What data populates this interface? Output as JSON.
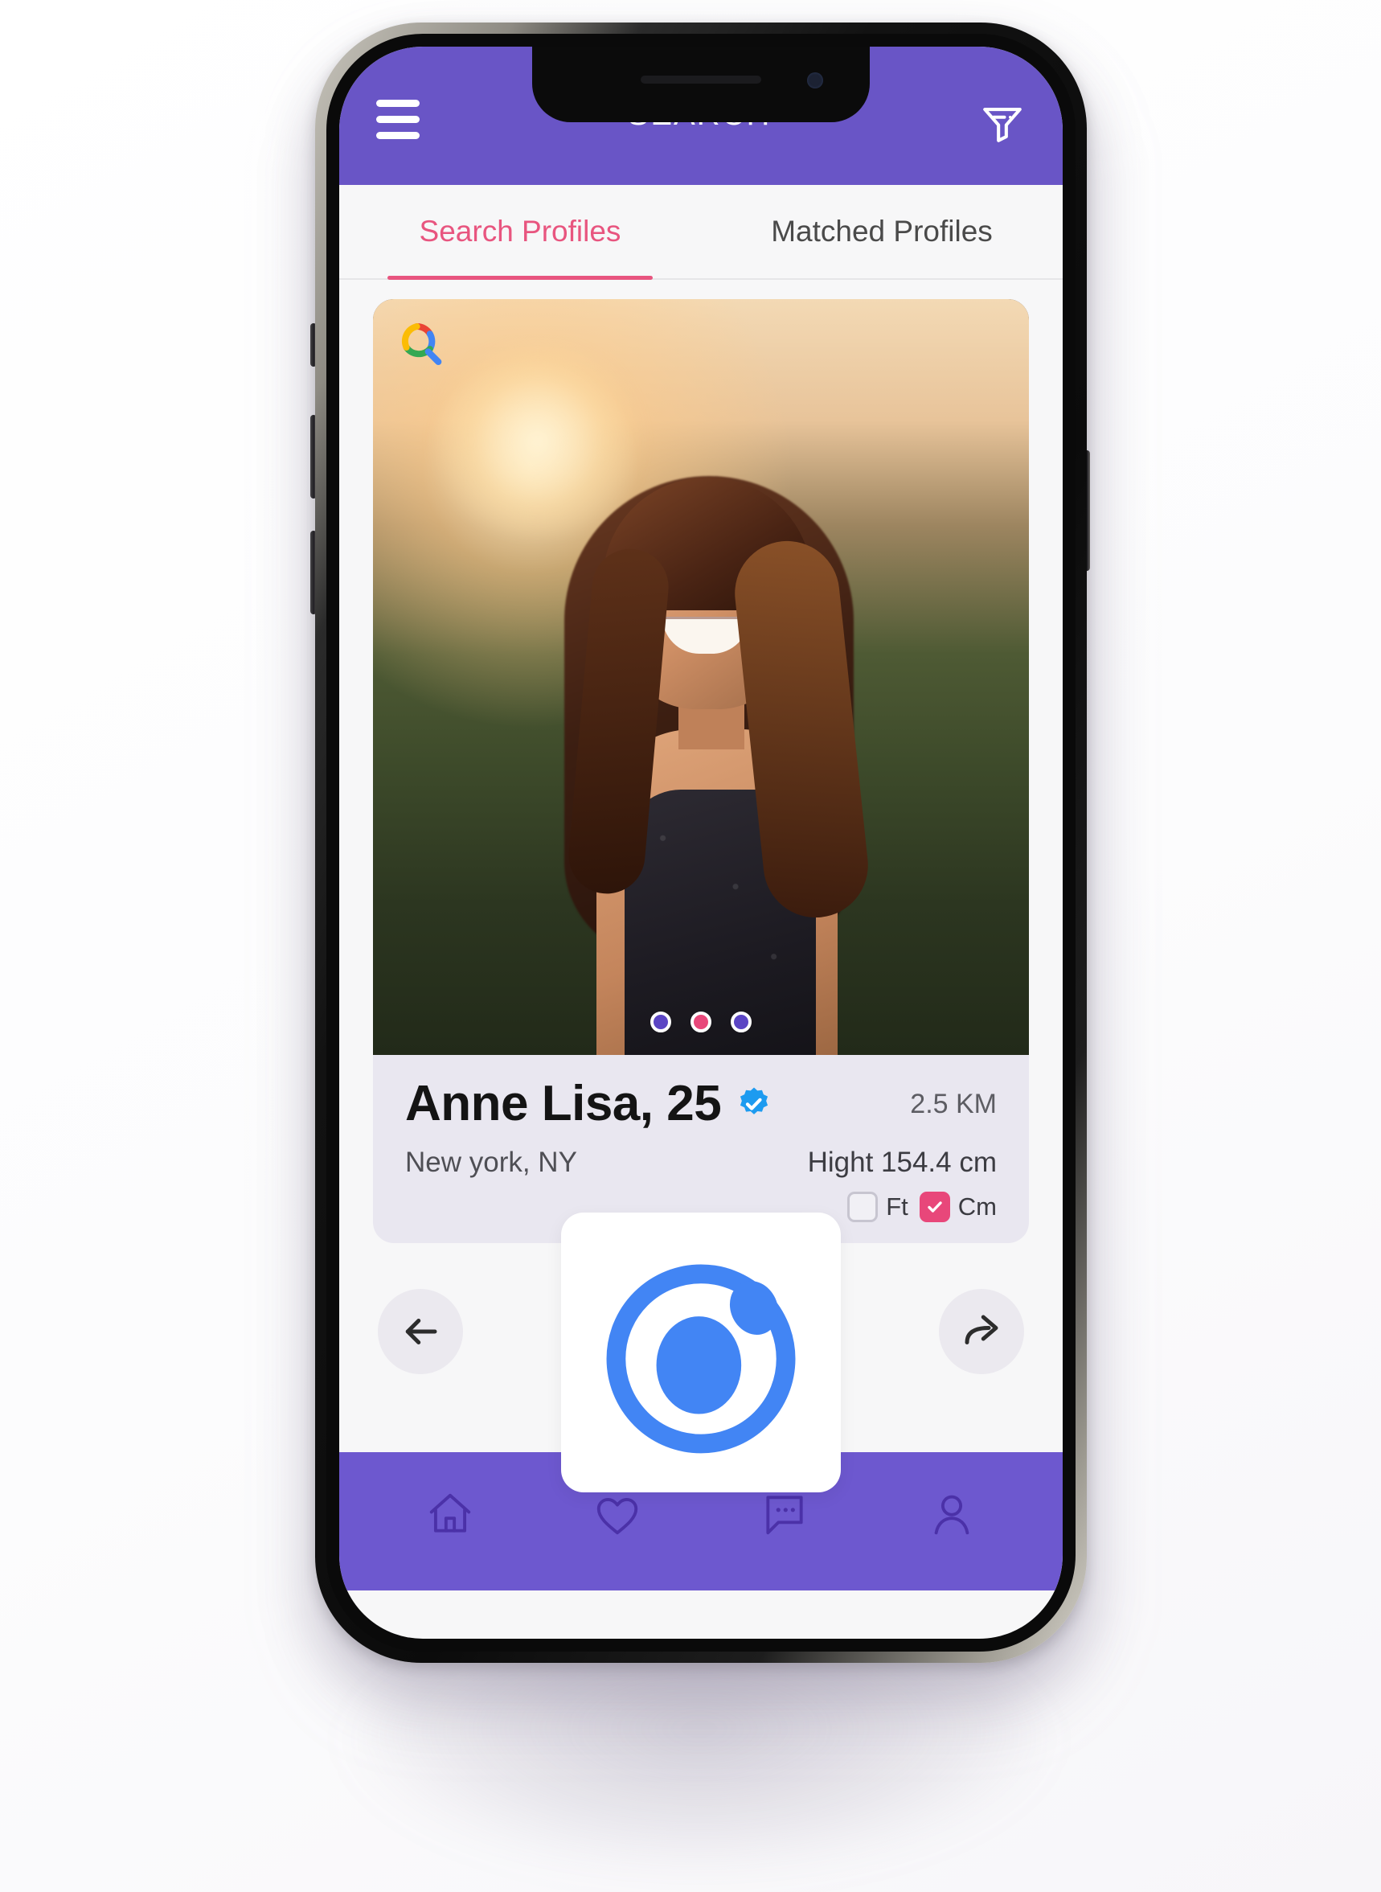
{
  "app": {
    "header": {
      "title": "SEARCH",
      "menu_icon": "hamburger-menu-icon",
      "filter_icon": "filter-funnel-icon",
      "background_color": "#6955c6"
    },
    "tabs": [
      {
        "label": "Search Profiles",
        "active": true,
        "color": "#e8557f"
      },
      {
        "label": "Matched Profiles",
        "active": false,
        "color": "#4a4a4a"
      }
    ],
    "profile_card": {
      "search_overlay_icon": "google-search-icon",
      "carousel": {
        "count": 3,
        "active_index": 1,
        "dot_colors": [
          "#5b45c4",
          "#e8477a",
          "#5b45c4"
        ]
      },
      "name": "Anne Lisa, 25",
      "verified_badge": "verified-check-icon",
      "distance": "2.5 KM",
      "location": "New york, NY",
      "height": "Hight 154.4 cm",
      "units": [
        {
          "label": "Ft",
          "checked": false
        },
        {
          "label": "Cm",
          "checked": true
        }
      ],
      "accent_color": "#e8477a",
      "panel_color": "#e9e7f0"
    },
    "actions": [
      {
        "name": "back-button",
        "icon": "arrow-left-icon"
      },
      {
        "name": "dislike-button",
        "icon": "thumbs-down-icon"
      },
      {
        "name": "like-button",
        "icon": "thumbs-up-icon"
      },
      {
        "name": "share-button",
        "icon": "arrow-forward-icon"
      }
    ],
    "overlay_logo": {
      "name": "ionic-logo",
      "color": "#4285f4"
    },
    "bottom_nav": [
      {
        "name": "nav-home",
        "icon": "home-icon"
      },
      {
        "name": "nav-favorites",
        "icon": "heart-icon"
      },
      {
        "name": "nav-messages",
        "icon": "chat-bubble-icon"
      },
      {
        "name": "nav-profile",
        "icon": "person-icon"
      }
    ],
    "bottom_nav_color": "#6d58cf"
  }
}
